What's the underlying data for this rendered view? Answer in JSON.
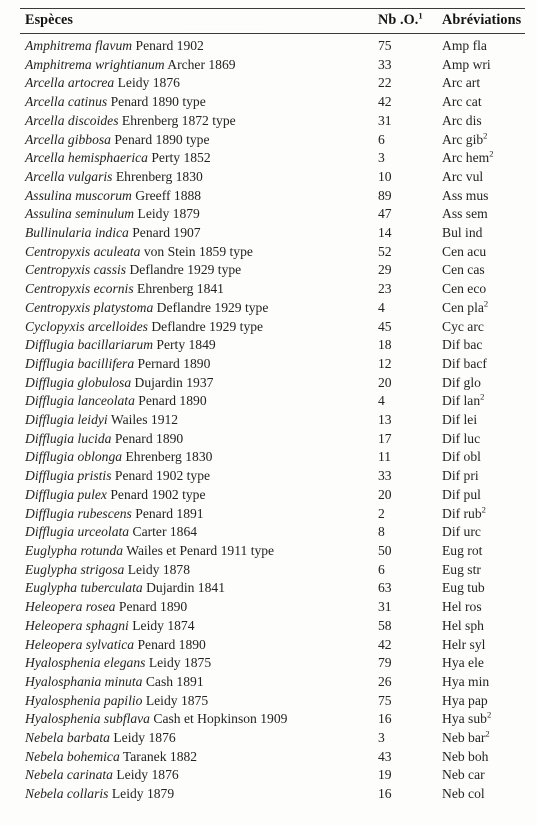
{
  "table": {
    "columns": {
      "species": "Espèces",
      "count": "Nb .O.",
      "count_footnote": "1",
      "abbreviation": "Abréviations"
    },
    "rows": [
      {
        "genus_species": "Amphitrema flavum",
        "authority": "Penard 1902",
        "count": "75",
        "abbr": "Amp fla",
        "abbr_footnote": ""
      },
      {
        "genus_species": "Amphitrema wrightianum",
        "authority": "Archer 1869",
        "count": "33",
        "abbr": "Amp wri",
        "abbr_footnote": ""
      },
      {
        "genus_species": "Arcella artocrea",
        "authority": "Leidy 1876",
        "count": "22",
        "abbr": "Arc art",
        "abbr_footnote": ""
      },
      {
        "genus_species": "Arcella catinus",
        "authority": "Penard 1890 type",
        "count": "42",
        "abbr": "Arc cat",
        "abbr_footnote": ""
      },
      {
        "genus_species": "Arcella discoides",
        "authority": "Ehrenberg 1872 type",
        "count": "31",
        "abbr": "Arc dis",
        "abbr_footnote": ""
      },
      {
        "genus_species": "Arcella gibbosa",
        "authority": "Penard 1890 type",
        "count": "6",
        "abbr": "Arc gib",
        "abbr_footnote": "2"
      },
      {
        "genus_species": "Arcella hemisphaerica",
        "authority": "Perty 1852",
        "count": "3",
        "abbr": "Arc hem",
        "abbr_footnote": "2"
      },
      {
        "genus_species": "Arcella vulgaris",
        "authority": "Ehrenberg 1830",
        "count": "10",
        "abbr": "Arc vul",
        "abbr_footnote": ""
      },
      {
        "genus_species": "Assulina muscorum",
        "authority": "Greeff 1888",
        "count": "89",
        "abbr": "Ass mus",
        "abbr_footnote": ""
      },
      {
        "genus_species": "Assulina seminulum",
        "authority": "Leidy 1879",
        "count": "47",
        "abbr": "Ass sem",
        "abbr_footnote": ""
      },
      {
        "genus_species": "Bullinularia indica",
        "authority": "Penard 1907",
        "count": "14",
        "abbr": "Bul ind",
        "abbr_footnote": ""
      },
      {
        "genus_species": "Centropyxis aculeata",
        "authority": "von Stein 1859 type",
        "count": "52",
        "abbr": "Cen acu",
        "abbr_footnote": ""
      },
      {
        "genus_species": "Centropyxis cassis",
        "authority": "Deflandre 1929 type",
        "count": "29",
        "abbr": "Cen cas",
        "abbr_footnote": ""
      },
      {
        "genus_species": "Centropyxis ecornis",
        "authority": "Ehrenberg 1841",
        "count": "23",
        "abbr": "Cen eco",
        "abbr_footnote": ""
      },
      {
        "genus_species": "Centropyxis platystoma",
        "authority": "Deflandre 1929 type",
        "count": "4",
        "abbr": "Cen pla",
        "abbr_footnote": "2"
      },
      {
        "genus_species": "Cyclopyxis arcelloides",
        "authority": "Deflandre 1929 type",
        "count": "45",
        "abbr": "Cyc arc",
        "abbr_footnote": ""
      },
      {
        "genus_species": "Difflugia bacillariarum",
        "authority": "Perty 1849",
        "count": "18",
        "abbr": "Dif bac",
        "abbr_footnote": ""
      },
      {
        "genus_species": "Difflugia bacillifera",
        "authority": "Pernard 1890",
        "count": "12",
        "abbr": "Dif bacf",
        "abbr_footnote": ""
      },
      {
        "genus_species": "Difflugia globulosa",
        "authority": "Dujardin 1937",
        "count": "20",
        "abbr": "Dif glo",
        "abbr_footnote": ""
      },
      {
        "genus_species": "Difflugia lanceolata",
        "authority": "Penard 1890",
        "count": "4",
        "abbr": "Dif lan",
        "abbr_footnote": "2"
      },
      {
        "genus_species": "Difflugia leidyi",
        "authority": "Wailes 1912",
        "count": "13",
        "abbr": "Dif lei",
        "abbr_footnote": ""
      },
      {
        "genus_species": "Difflugia lucida",
        "authority": "Penard 1890",
        "count": "17",
        "abbr": "Dif luc",
        "abbr_footnote": ""
      },
      {
        "genus_species": "Difflugia oblonga",
        "authority": "Ehrenberg 1830",
        "count": "11",
        "abbr": "Dif obl",
        "abbr_footnote": ""
      },
      {
        "genus_species": "Difflugia pristis",
        "authority": "Penard 1902 type",
        "count": "33",
        "abbr": "Dif pri",
        "abbr_footnote": ""
      },
      {
        "genus_species": "Difflugia pulex",
        "authority": "Penard 1902 type",
        "count": "20",
        "abbr": "Dif pul",
        "abbr_footnote": ""
      },
      {
        "genus_species": "Difflugia rubescens",
        "authority": "Penard 1891",
        "count": "2",
        "abbr": "Dif rub",
        "abbr_footnote": "2"
      },
      {
        "genus_species": "Difflugia urceolata",
        "authority": "Carter 1864",
        "count": "8",
        "abbr": "Dif urc",
        "abbr_footnote": ""
      },
      {
        "genus_species": "Euglypha rotunda",
        "authority": "Wailes et Penard 1911 type",
        "count": "50",
        "abbr": "Eug rot",
        "abbr_footnote": ""
      },
      {
        "genus_species": "Euglypha strigosa",
        "authority": "Leidy 1878",
        "count": "6",
        "abbr": "Eug str",
        "abbr_footnote": ""
      },
      {
        "genus_species": "Euglypha tuberculata",
        "authority": "Dujardin 1841",
        "count": "63",
        "abbr": "Eug tub",
        "abbr_footnote": ""
      },
      {
        "genus_species": "Heleopera rosea",
        "authority": "Penard 1890",
        "count": "31",
        "abbr": "Hel ros",
        "abbr_footnote": ""
      },
      {
        "genus_species": "Heleopera sphagni",
        "authority": "Leidy 1874",
        "count": "58",
        "abbr": "Hel sph",
        "abbr_footnote": ""
      },
      {
        "genus_species": "Heleopera sylvatica",
        "authority": "Penard 1890",
        "count": "42",
        "abbr": "Helr syl",
        "abbr_footnote": ""
      },
      {
        "genus_species": "Hyalosphenia elegans",
        "authority": "Leidy 1875",
        "count": "79",
        "abbr": "Hya ele",
        "abbr_footnote": ""
      },
      {
        "genus_species": "Hyalosphania minuta",
        "authority": "Cash 1891",
        "count": "26",
        "abbr": "Hya min",
        "abbr_footnote": ""
      },
      {
        "genus_species": "Hyalosphenia papilio",
        "authority": "Leidy 1875",
        "count": "75",
        "abbr": "Hya pap",
        "abbr_footnote": ""
      },
      {
        "genus_species": "Hyalosphenia subflava",
        "authority": "Cash et Hopkinson 1909",
        "count": "16",
        "abbr": "Hya sub",
        "abbr_footnote": "2"
      },
      {
        "genus_species": "Nebela barbata",
        "authority": "Leidy 1876",
        "count": "3",
        "abbr": "Neb bar",
        "abbr_footnote": "2"
      },
      {
        "genus_species": "Nebela bohemica",
        "authority": "Taranek 1882",
        "count": "43",
        "abbr": "Neb boh",
        "abbr_footnote": ""
      },
      {
        "genus_species": "Nebela carinata",
        "authority": "Leidy 1876",
        "count": "19",
        "abbr": "Neb car",
        "abbr_footnote": ""
      },
      {
        "genus_species": "Nebela collaris",
        "authority": "Leidy 1879",
        "count": "16",
        "abbr": "Neb col",
        "abbr_footnote": ""
      }
    ]
  }
}
